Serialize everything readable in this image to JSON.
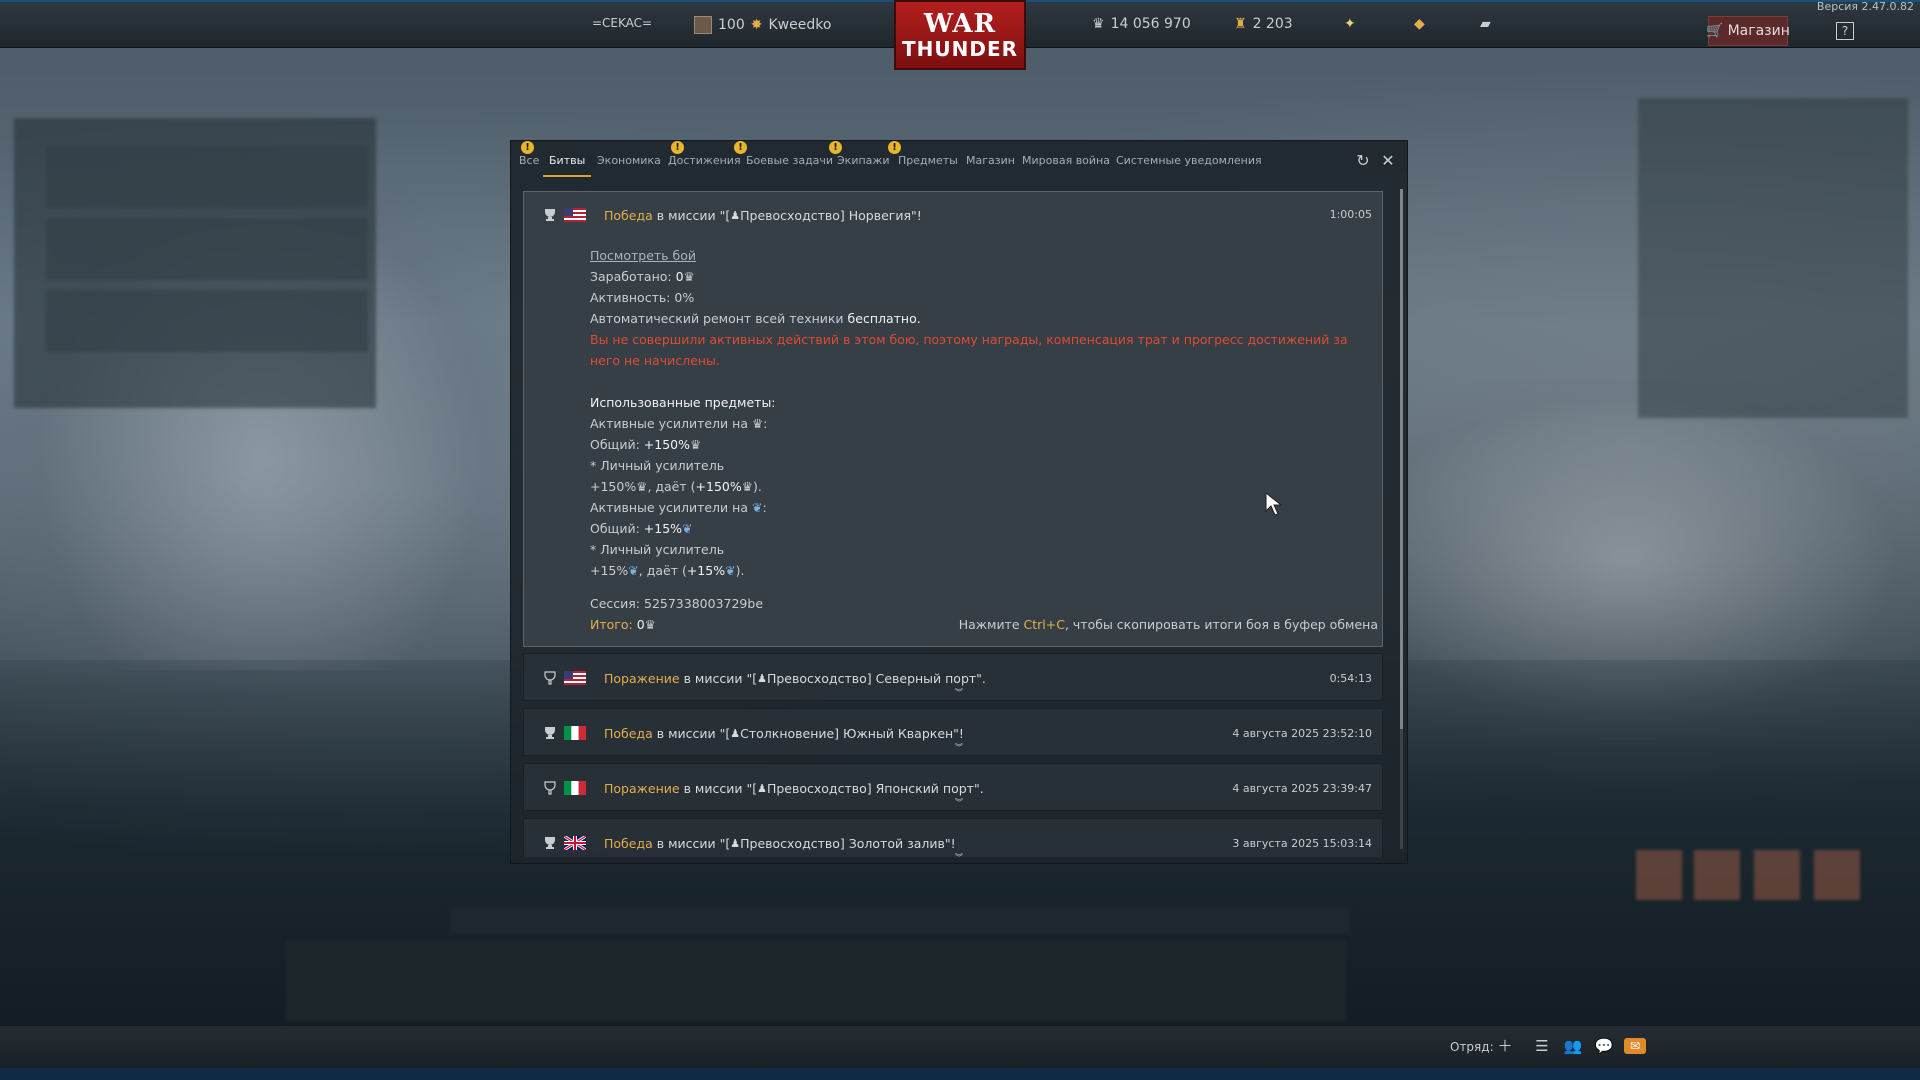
{
  "version": "Версия 2.47.0.82",
  "topbar": {
    "squad_tag": "=CEKAC=",
    "player_level": "100",
    "player_name": "Kweedko",
    "silver_lions": "14 056 970",
    "golden_eagles": "2 203",
    "shop_label": "Магазин",
    "help_label": "?"
  },
  "logo": {
    "line1": "WAR",
    "line2": "THUNDER"
  },
  "tabs": [
    {
      "label": "Все",
      "badge": "!"
    },
    {
      "label": "Битвы",
      "active": true
    },
    {
      "label": "Экономика"
    },
    {
      "label": "Достижения",
      "badge": "!"
    },
    {
      "label": "Боевые задачи",
      "badge": "!"
    },
    {
      "label": "Экипажи",
      "badge": "!"
    },
    {
      "label": "Предметы",
      "badge": "!"
    },
    {
      "label": "Магазин"
    },
    {
      "label": "Мировая война"
    },
    {
      "label": "Системные уведомления"
    }
  ],
  "battles": [
    {
      "result": "Победа",
      "text": "в миссии \"[",
      "mission": " Превосходство] Норвегия\"!",
      "time": "1:00:05",
      "nation": "usa",
      "expanded": true,
      "details": {
        "view_battle": "Посмотреть бой",
        "earned_label": "Заработано: ",
        "earned_value": "0",
        "activity": "Активность: 0%",
        "repair_prefix": "Автоматический ремонт всей техники ",
        "repair_value": "бесплатно.",
        "warning": "Вы не совершили активных действий в этом бою, поэтому награды, компенсация трат и прогресс достижений за него не начислены.",
        "used_items": "Использованные предметы:",
        "boosters_sl": "Активные усилители на ",
        "total_sl_label": "Общий: ",
        "total_sl_value": "+150%",
        "personal_booster_1": "* Личный усилитель",
        "personal_sl_1": "+150%",
        "gives": ", даёт (",
        "gives_sl_value": "+150%",
        "close_paren": ").",
        "boosters_rp": "Активные усилители на ",
        "total_rp_label": "Общий: ",
        "total_rp_value": "+15%",
        "personal_booster_2": "* Личный усилитель",
        "personal_rp_2": "+15%",
        "gives_rp_value": "+15%",
        "session": "Сессия: 5257338003729be",
        "total_label": "Итого: ",
        "total_value": "0",
        "hint_prefix": "Нажмите ",
        "hint_key": "Ctrl+C",
        "hint_suffix": ", чтобы скопировать итоги боя в буфер обмена"
      }
    },
    {
      "result": "Поражение",
      "text": "в миссии \"[",
      "mission": " Превосходство] Северный порт\".",
      "time": "0:54:13",
      "nation": "usa"
    },
    {
      "result": "Победа",
      "text": "в миссии \"[",
      "mission": " Столкновение] Южный Кваркен\"!",
      "time": "4 августа 2025 23:52:10",
      "nation": "italy"
    },
    {
      "result": "Поражение",
      "text": "в миссии \"[",
      "mission": " Превосходство] Японский порт\".",
      "time": "4 августа 2025 23:39:47",
      "nation": "italy"
    },
    {
      "result": "Победа",
      "text": "в миссии \"[",
      "mission": " Превосходство] Золотой залив\"!",
      "time": "3 августа 2025 15:03:14",
      "nation": "uk"
    }
  ],
  "bottombar": {
    "squad_label": "Отряд:"
  }
}
